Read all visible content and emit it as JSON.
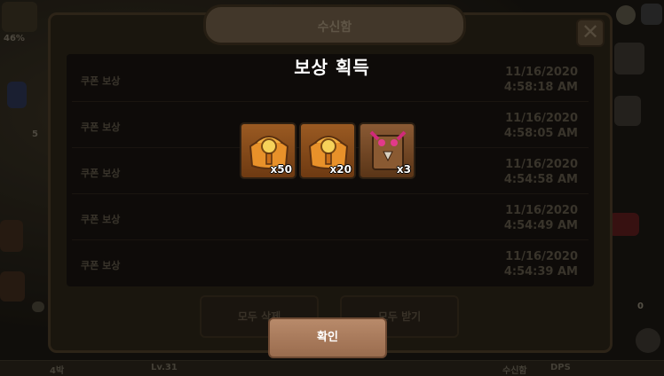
{
  "background": {
    "hud_left": [
      "46%",
      "5"
    ],
    "hud_right": [
      "0"
    ],
    "bottom_bar": [
      "4박",
      "Lv.31",
      "수신함",
      "DPS"
    ]
  },
  "mailbox": {
    "title": "수신함",
    "rows": [
      {
        "label": "쿠폰 보상",
        "date": "11/16/2020",
        "time": "4:58:18 AM"
      },
      {
        "label": "쿠폰 보상",
        "date": "11/16/2020",
        "time": "4:58:05 AM"
      },
      {
        "label": "쿠폰 보상",
        "date": "11/16/2020",
        "time": "4:54:58 AM"
      },
      {
        "label": "쿠폰 보상",
        "date": "11/16/2020",
        "time": "4:54:49 AM"
      },
      {
        "label": "쿠폰 보상",
        "date": "11/16/2020",
        "time": "4:54:39 AM"
      }
    ],
    "footer_buttons": [
      "모두 삭제",
      "모두 받기"
    ]
  },
  "popup": {
    "title": "보상 획득",
    "rewards": [
      {
        "icon": "gold-chest-icon",
        "count": "x50"
      },
      {
        "icon": "gold-chest-icon",
        "count": "x20"
      },
      {
        "icon": "demon-chest-icon",
        "count": "x3"
      }
    ],
    "confirm_label": "확인"
  },
  "colors": {
    "confirm_button": "#a87a5c",
    "popup_title": "#ffffff",
    "slot_border": "#2d2013"
  }
}
